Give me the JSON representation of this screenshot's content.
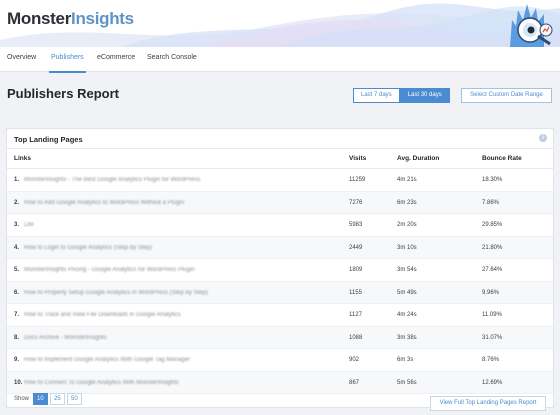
{
  "brand": {
    "logo_part1": "Monster",
    "logo_part2": "Insights"
  },
  "tabs": [
    {
      "label": "Overview"
    },
    {
      "label": "Publishers"
    },
    {
      "label": "eCommerce"
    },
    {
      "label": "Search Console"
    }
  ],
  "page": {
    "title": "Publishers Report",
    "range_buttons": [
      "Last 7 days",
      "Last 30 days"
    ],
    "custom_range": "Select Custom Date Range"
  },
  "panel": {
    "title": "Top Landing Pages",
    "info_icon": "i",
    "columns": [
      "Links",
      "Visits",
      "Avg. Duration",
      "Bounce Rate"
    ],
    "rows": [
      {
        "num": "1.",
        "link": "MonsterInsights - The Best Google Analytics Plugin for WordPress",
        "visits": "11259",
        "duration": "4m 21s",
        "bounce": "18.30%"
      },
      {
        "num": "2.",
        "link": "How to Add Google Analytics to WordPress Without a Plugin",
        "visits": "7276",
        "duration": "6m 23s",
        "bounce": "7.86%"
      },
      {
        "num": "3.",
        "link": "Lite",
        "visits": "5983",
        "duration": "2m 20s",
        "bounce": "29.85%"
      },
      {
        "num": "4.",
        "link": "How to Login to Google Analytics (Step by Step)",
        "visits": "2449",
        "duration": "3m 10s",
        "bounce": "21.80%"
      },
      {
        "num": "5.",
        "link": "MonsterInsights Pricing - Google Analytics for WordPress Plugin",
        "visits": "1809",
        "duration": "3m 54s",
        "bounce": "27.64%"
      },
      {
        "num": "6.",
        "link": "How to Properly Setup Google Analytics in WordPress (Step by Step)",
        "visits": "1155",
        "duration": "5m 49s",
        "bounce": "9.96%"
      },
      {
        "num": "7.",
        "link": "How to Track and View File Downloads in Google Analytics",
        "visits": "1127",
        "duration": "4m 24s",
        "bounce": "11.09%"
      },
      {
        "num": "8.",
        "link": "Docs Archive - MonsterInsights",
        "visits": "1088",
        "duration": "3m 38s",
        "bounce": "31.07%"
      },
      {
        "num": "9.",
        "link": "How to Implement Google Analytics With Google Tag Manager",
        "visits": "902",
        "duration": "6m 3s",
        "bounce": "8.76%"
      },
      {
        "num": "10.",
        "link": "How to Connect To Google Analytics With MonsterInsights",
        "visits": "867",
        "duration": "5m 56s",
        "bounce": "12.69%"
      }
    ],
    "show_label": "Show",
    "page_sizes": [
      "10",
      "25",
      "50"
    ],
    "full_report": "View Full Top Landing Pages Report"
  },
  "colors": {
    "accent": "#4b8bd1",
    "brand_blue": "#5f93c5",
    "background": "#f0f2f6"
  },
  "icons": {
    "mascot": "monster-mascot-icon",
    "info": "info-icon"
  }
}
